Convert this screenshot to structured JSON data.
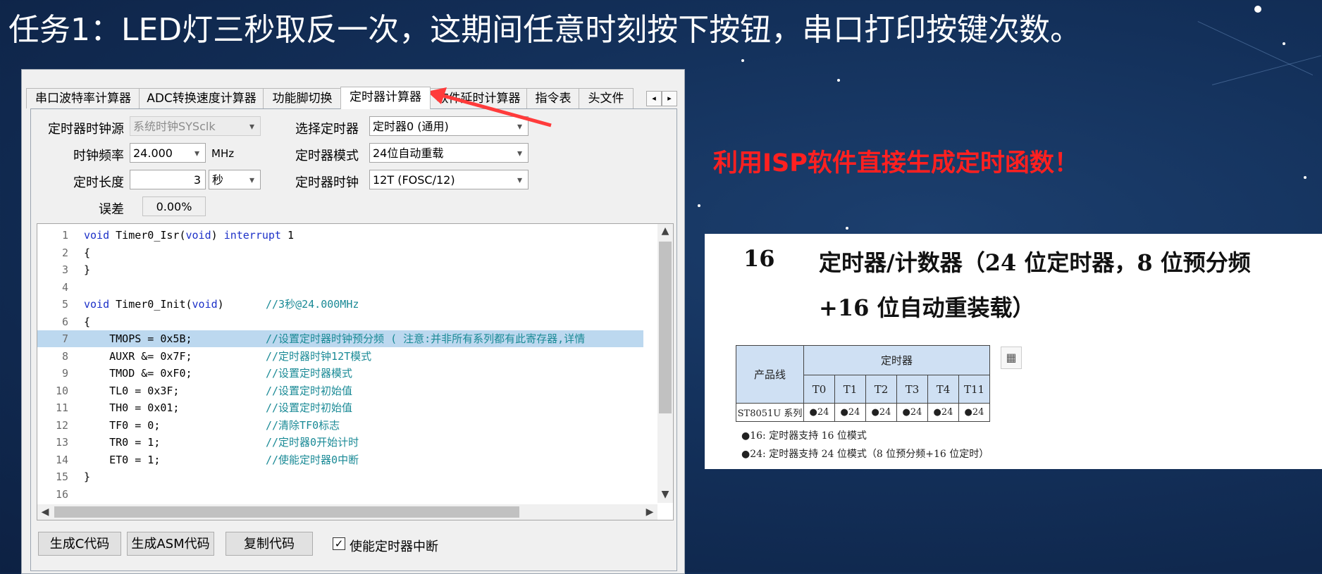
{
  "slide": {
    "title": "任务1：LED灯三秒取反一次，这期间任意时刻按下按钮，串口打印按键次数。",
    "annotation": "利用ISP软件直接生成定时函数！"
  },
  "isp_window": {
    "tabs": [
      "串口波特率计算器",
      "ADC转换速度计算器",
      "功能脚切换",
      "定时器计算器",
      "软件延时计算器",
      "指令表",
      "头文件"
    ],
    "active_tab": "定时器计算器",
    "scroll_left": "◂",
    "scroll_right": "▸",
    "form": {
      "clock_source_label": "定时器时钟源",
      "clock_source_value": "系统时钟SYSclk",
      "freq_label": "时钟频率",
      "freq_value": "24.000",
      "freq_unit": "MHz",
      "length_label": "定时长度",
      "length_value": "3",
      "length_unit": "秒",
      "error_label": "误差",
      "error_value": "0.00%",
      "select_timer_label": "选择定时器",
      "select_timer_value": "定时器0 (通用)",
      "mode_label": "定时器模式",
      "mode_value": "24位自动重载",
      "timer_clock_label": "定时器时钟",
      "timer_clock_value": "12T (FOSC/12)"
    },
    "code_lines": [
      {
        "num": "1",
        "kw": "void",
        "code": " Timer0_Isr(",
        "kw2": "void",
        "code2": ") ",
        "kw3": "interrupt",
        "code3": " 1",
        "comment": ""
      },
      {
        "num": "2",
        "kw": "",
        "code": "{",
        "kw2": "",
        "code2": "",
        "kw3": "",
        "code3": "",
        "comment": ""
      },
      {
        "num": "3",
        "kw": "",
        "code": "}",
        "kw2": "",
        "code2": "",
        "kw3": "",
        "code3": "",
        "comment": ""
      },
      {
        "num": "4",
        "kw": "",
        "code": "",
        "kw2": "",
        "code2": "",
        "kw3": "",
        "code3": "",
        "comment": ""
      },
      {
        "num": "5",
        "kw": "void",
        "code": " Timer0_Init(",
        "kw2": "void",
        "code2": ")",
        "kw3": "",
        "code3": "",
        "comment": "//3秒@24.000MHz"
      },
      {
        "num": "6",
        "kw": "",
        "code": "{",
        "kw2": "",
        "code2": "",
        "kw3": "",
        "code3": "",
        "comment": ""
      },
      {
        "num": "7",
        "kw": "",
        "code": "    TMOPS = 0x5B;",
        "kw2": "",
        "code2": "",
        "kw3": "",
        "code3": "",
        "comment": "//设置定时器时钟预分频 ( 注意:并非所有系列都有此寄存器,详情"
      },
      {
        "num": "8",
        "kw": "",
        "code": "    AUXR &= 0x7F;",
        "kw2": "",
        "code2": "",
        "kw3": "",
        "code3": "",
        "comment": "//定时器时钟12T模式"
      },
      {
        "num": "9",
        "kw": "",
        "code": "    TMOD &= 0xF0;",
        "kw2": "",
        "code2": "",
        "kw3": "",
        "code3": "",
        "comment": "//设置定时器模式"
      },
      {
        "num": "10",
        "kw": "",
        "code": "    TL0 = 0x3F;",
        "kw2": "",
        "code2": "",
        "kw3": "",
        "code3": "",
        "comment": "//设置定时初始值"
      },
      {
        "num": "11",
        "kw": "",
        "code": "    TH0 = 0x01;",
        "kw2": "",
        "code2": "",
        "kw3": "",
        "code3": "",
        "comment": "//设置定时初始值"
      },
      {
        "num": "12",
        "kw": "",
        "code": "    TF0 = 0;",
        "kw2": "",
        "code2": "",
        "kw3": "",
        "code3": "",
        "comment": "//清除TF0标志"
      },
      {
        "num": "13",
        "kw": "",
        "code": "    TR0 = 1;",
        "kw2": "",
        "code2": "",
        "kw3": "",
        "code3": "",
        "comment": "//定时器0开始计时"
      },
      {
        "num": "14",
        "kw": "",
        "code": "    ET0 = 1;",
        "kw2": "",
        "code2": "",
        "kw3": "",
        "code3": "",
        "comment": "//使能定时器0中断"
      },
      {
        "num": "15",
        "kw": "",
        "code": "}",
        "kw2": "",
        "code2": "",
        "kw3": "",
        "code3": "",
        "comment": ""
      },
      {
        "num": "16",
        "kw": "",
        "code": "",
        "kw2": "",
        "code2": "",
        "kw3": "",
        "code3": "",
        "comment": ""
      }
    ],
    "highlighted_line": 7,
    "buttons": {
      "gen_c": "生成C代码",
      "gen_asm": "生成ASM代码",
      "copy": "复制代码",
      "enable_irq": "使能定时器中断"
    },
    "enable_irq_checked": true,
    "check_mark": "✓"
  },
  "datasheet": {
    "section_num": "16",
    "section_title_line1": "定时器/计数器（24 位定时器，8 位预分频",
    "section_title_line2": "+16 位自动重装载）",
    "table_header_left": "产品线",
    "table_header_group": "定时器",
    "columns": [
      "T0",
      "T1",
      "T2",
      "T3",
      "T4",
      "T11"
    ],
    "row_label": "ST8051U 系列",
    "row_values": [
      "●24",
      "●24",
      "●24",
      "●24",
      "●24",
      "●24"
    ],
    "note1_mark": "●16:",
    "note1_text": "定时器支持 16 位模式",
    "note2_mark": "●24:",
    "note2_text": "定时器支持 24 位模式（8 位预分频+16 位定时）",
    "copy_icon": "table-copy-icon"
  },
  "colors": {
    "background": "#13305a",
    "annotation": "#ff2020",
    "keyword": "#1c30c8",
    "comment": "#1a8a96",
    "highlight": "#bcd8ef",
    "table_header": "#cfe0f3"
  }
}
